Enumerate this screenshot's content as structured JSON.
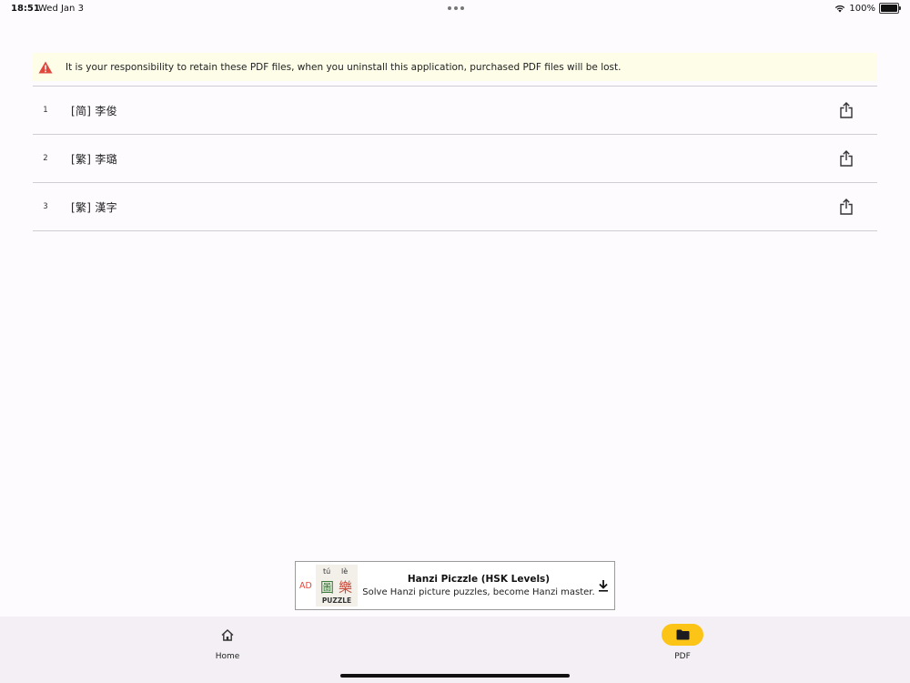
{
  "status_bar": {
    "time": "18:51",
    "date": "Wed Jan 3",
    "battery": "100%"
  },
  "warning": {
    "text": "It is your responsibility to retain these PDF files, when you uninstall this application, purchased PDF files will be lost.",
    "color": "#e0483d"
  },
  "files": [
    {
      "index": "1",
      "name": "[简] 李俊"
    },
    {
      "index": "2",
      "name": "[繁] 李璐"
    },
    {
      "index": "3",
      "name": "[繁] 漢字"
    }
  ],
  "ad": {
    "label": "AD",
    "thumb_pinyin_1": "tú",
    "thumb_pinyin_2": "lè",
    "thumb_char_1": "圖",
    "thumb_char_2": "樂",
    "thumb_caption": "PUZZLE",
    "title": "Hanzi Piczzle (HSK Levels)",
    "subtitle": "Solve Hanzi picture puzzles, become Hanzi master."
  },
  "nav": {
    "home_label": "Home",
    "pdf_label": "PDF",
    "active": "PDF",
    "accent": "#fcc417"
  }
}
